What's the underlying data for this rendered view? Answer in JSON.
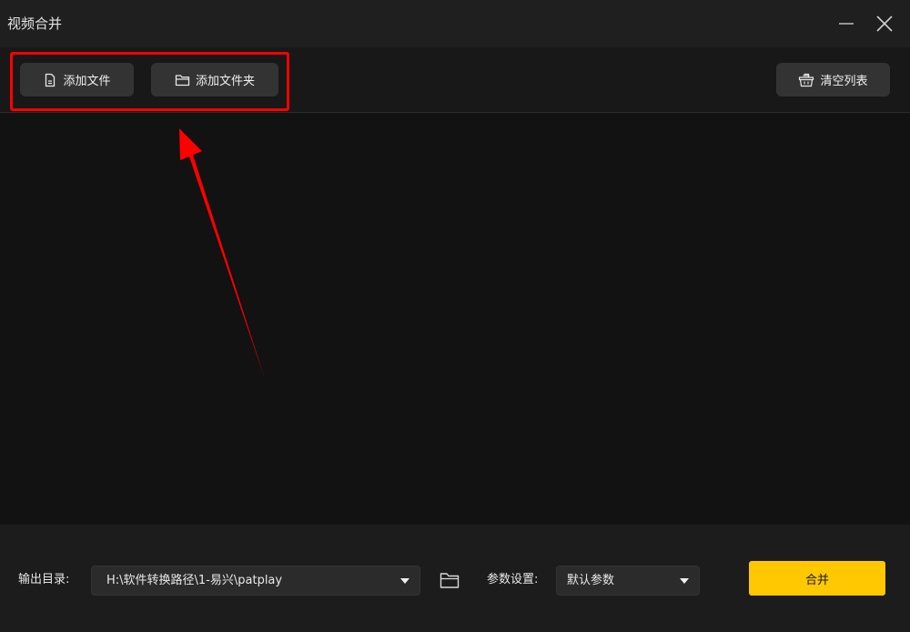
{
  "window": {
    "title": "视频合并"
  },
  "toolbar": {
    "add_file_label": "添加文件",
    "add_folder_label": "添加文件夹",
    "clear_list_label": "清空列表"
  },
  "bottom": {
    "output_dir_label": "输出目录:",
    "output_dir_value": "H:\\软件转换路径\\1-易兴\\patplay",
    "params_label": "参数设置:",
    "params_value": "默认参数",
    "merge_label": "合并"
  },
  "colors": {
    "accent": "#ffc800",
    "annotation": "#ff0000",
    "background": "#121212"
  },
  "icons": {
    "add_file": "file-icon",
    "add_folder": "folder-icon",
    "clear_list": "basket-icon",
    "minimize": "minimize-icon",
    "close": "close-icon",
    "browse": "folder-open-icon",
    "dropdown": "caret-down-icon"
  }
}
